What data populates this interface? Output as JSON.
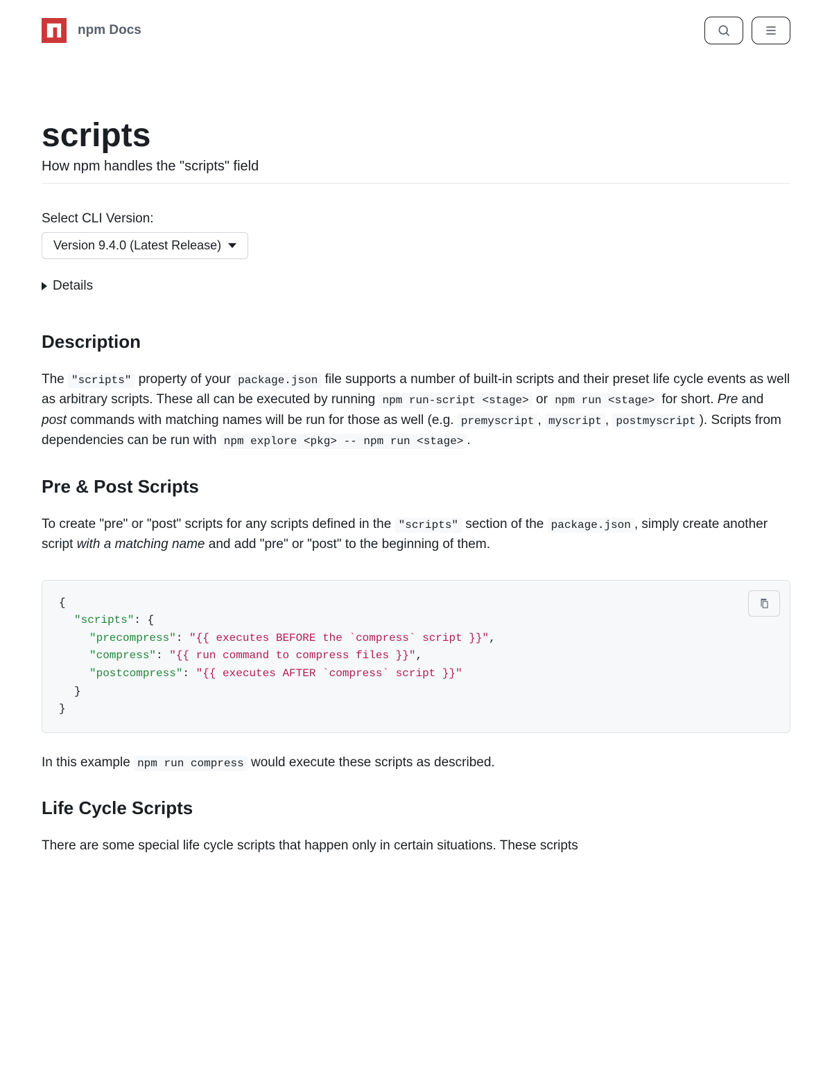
{
  "header": {
    "docs_label": "npm Docs"
  },
  "page": {
    "title": "scripts",
    "subtitle": "How npm handles the \"scripts\" field",
    "version_label": "Select CLI Version:",
    "version_selected": "Version 9.4.0 (Latest Release)",
    "details_label": "Details"
  },
  "sections": {
    "description": {
      "heading": "Description",
      "p1_a": "The ",
      "p1_code1": "\"scripts\"",
      "p1_b": " property of your ",
      "p1_code2": "package.json",
      "p1_c": " file supports a number of built-in scripts and their preset life cycle events as well as arbitrary scripts. These all can be executed by running ",
      "p1_code3": "npm run-script <stage>",
      "p1_d": " or ",
      "p1_code4": "npm run <stage>",
      "p1_e": " for short. ",
      "p1_italic1": "Pre",
      "p1_f": " and ",
      "p1_italic2": "post",
      "p1_g": " commands with matching names will be run for those as well (e.g. ",
      "p1_code5": "premyscript",
      "p1_h": ", ",
      "p1_code6": "myscript",
      "p1_i": ", ",
      "p1_code7": "postmyscript",
      "p1_j": "). Scripts from dependencies can be run with ",
      "p1_code8": "npm explore <pkg> -- npm run <stage>",
      "p1_k": "."
    },
    "prepost": {
      "heading": "Pre & Post Scripts",
      "p1_a": "To create \"pre\" or \"post\" scripts for any scripts defined in the ",
      "p1_code1": "\"scripts\"",
      "p1_b": " section of the ",
      "p1_code2": "package.json",
      "p1_c": ", simply create another script ",
      "p1_italic1": "with a matching name",
      "p1_d": " and add \"pre\" or \"post\" to the beginning of them.",
      "code": {
        "l1": "{",
        "l2_key": "\"scripts\"",
        "l2_rest": ": {",
        "l3_key": "\"precompress\"",
        "l3_colon": ": ",
        "l3_val": "\"{{ executes BEFORE the `compress` script }}\"",
        "l3_end": ",",
        "l4_key": "\"compress\"",
        "l4_colon": ": ",
        "l4_val": "\"{{ run command to compress files }}\"",
        "l4_end": ",",
        "l5_key": "\"postcompress\"",
        "l5_colon": ": ",
        "l5_val": "\"{{ executes AFTER `compress` script }}\"",
        "l6": "}",
        "l7": "}"
      },
      "p2_a": "In this example ",
      "p2_code1": "npm run compress",
      "p2_b": " would execute these scripts as described."
    },
    "lifecycle": {
      "heading": "Life Cycle Scripts",
      "p1": "There are some special life cycle scripts that happen only in certain situations. These scripts"
    }
  }
}
